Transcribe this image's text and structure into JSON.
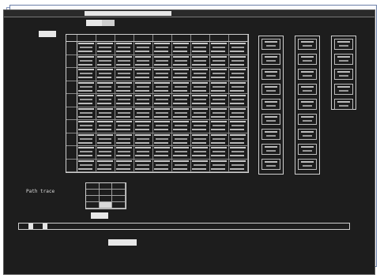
{
  "window": {
    "left_title": "",
    "center_title": "",
    "right_status": ""
  },
  "header": {
    "select_label": "",
    "select_value": "",
    "mode_value": "",
    "channel_label": "",
    "sonet_label": ""
  },
  "grid": {
    "column_headers": [
      "",
      "",
      "",
      "",
      "",
      "",
      "",
      "",
      ""
    ],
    "row_labels": [
      "",
      "",
      "",
      "",
      "",
      "",
      "",
      "",
      "",
      ""
    ]
  },
  "poh_columns": [
    {
      "label": ""
    },
    {
      "label": ""
    },
    {
      "label": ""
    }
  ],
  "path_trace": {
    "label": "Path trace"
  },
  "pointer": {
    "label": "",
    "value": ""
  },
  "bottom_bar": {
    "segments": [
      "",
      "",
      "",
      "",
      "",
      "",
      ""
    ]
  },
  "scc": {
    "label": "",
    "value": ""
  }
}
